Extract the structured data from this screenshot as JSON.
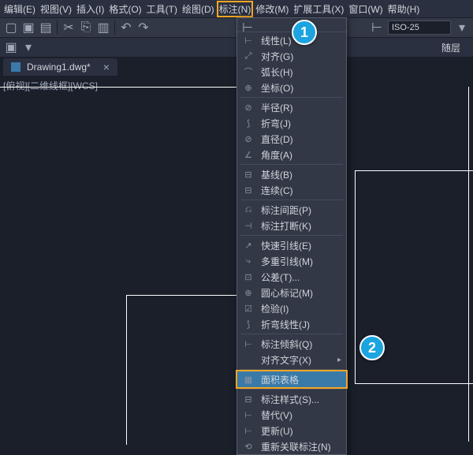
{
  "menubar": {
    "items": [
      {
        "label": "编辑(E)"
      },
      {
        "label": "视图(V)"
      },
      {
        "label": "插入(I)"
      },
      {
        "label": "格式(O)"
      },
      {
        "label": "工具(T)"
      },
      {
        "label": "绘图(D)"
      },
      {
        "label": "标注(N)",
        "highlighted": true
      },
      {
        "label": "修改(M)"
      },
      {
        "label": "扩展工具(X)"
      },
      {
        "label": "窗口(W)"
      },
      {
        "label": "帮助(H)"
      }
    ]
  },
  "toolbar": {
    "dim_style": "ISO-25",
    "layer_name": "随层"
  },
  "tab": {
    "filename": "Drawing1.dwg*"
  },
  "viewport": {
    "label": "[俯视][二维线框][WCS]"
  },
  "dropdown": {
    "topbar_icon": "quick-dim-icon",
    "groups": [
      [
        {
          "icon": "⊢",
          "label": "线性(L)",
          "name": "linear"
        },
        {
          "icon": "⤢",
          "label": "对齐(G)",
          "name": "aligned"
        },
        {
          "icon": "⌒",
          "label": "弧长(H)",
          "name": "arc-length"
        },
        {
          "icon": "⊕",
          "label": "坐标(O)",
          "name": "ordinate"
        }
      ],
      [
        {
          "icon": "⊘",
          "label": "半径(R)",
          "name": "radius"
        },
        {
          "icon": "⟆",
          "label": "折弯(J)",
          "name": "jogged"
        },
        {
          "icon": "⊘",
          "label": "直径(D)",
          "name": "diameter"
        },
        {
          "icon": "∠",
          "label": "角度(A)",
          "name": "angular"
        }
      ],
      [
        {
          "icon": "⊟",
          "label": "基线(B)",
          "name": "baseline"
        },
        {
          "icon": "⊟",
          "label": "连续(C)",
          "name": "continue"
        }
      ],
      [
        {
          "icon": "⎌",
          "label": "标注间距(P)",
          "name": "dim-space"
        },
        {
          "icon": "⊣",
          "label": "标注打断(K)",
          "name": "dim-break"
        }
      ],
      [
        {
          "icon": "↗",
          "label": "快速引线(E)",
          "name": "quick-leader"
        },
        {
          "icon": "⤷",
          "label": "多重引线(M)",
          "name": "multi-leader"
        },
        {
          "icon": "⊡",
          "label": "公差(T)...",
          "name": "tolerance"
        },
        {
          "icon": "⊕",
          "label": "圆心标记(M)",
          "name": "center-mark"
        },
        {
          "icon": "☑",
          "label": "检验(I)",
          "name": "inspect"
        },
        {
          "icon": "⟆",
          "label": "折弯线性(J)",
          "name": "jog-linear"
        }
      ],
      [
        {
          "icon": "⊢",
          "label": "标注倾斜(Q)",
          "name": "oblique"
        },
        {
          "icon": "",
          "label": "对齐文字(X)",
          "name": "align-text",
          "submenu": true
        }
      ],
      [
        {
          "icon": "▦",
          "label": "面积表格",
          "name": "area-table",
          "highlighted": true
        }
      ],
      [
        {
          "icon": "⊟",
          "label": "标注样式(S)...",
          "name": "dim-style"
        },
        {
          "icon": "⊢",
          "label": "替代(V)",
          "name": "override"
        },
        {
          "icon": "⊢",
          "label": "更新(U)",
          "name": "update"
        },
        {
          "icon": "⟲",
          "label": "重新关联标注(N)",
          "name": "reassociate"
        }
      ]
    ]
  },
  "callouts": {
    "one": "1",
    "two": "2"
  }
}
